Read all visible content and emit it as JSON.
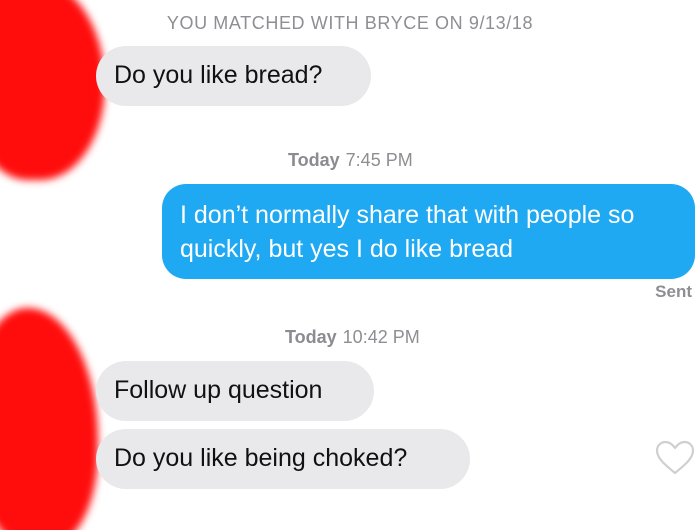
{
  "header": {
    "match_text": "YOU MATCHED WITH BRYCE ON 9/13/18"
  },
  "messages": [
    {
      "direction": "received",
      "text": "Do you like bread?"
    },
    {
      "direction": "sent",
      "text": "I don’t normally share that with people so quickly, but yes I do like bread"
    },
    {
      "direction": "received",
      "text": "Follow up question"
    },
    {
      "direction": "received",
      "text": "Do you like being choked?"
    }
  ],
  "timestamps": [
    {
      "day": "Today",
      "time": "7:45 PM"
    },
    {
      "day": "Today",
      "time": "10:42 PM"
    }
  ],
  "sent_status": "Sent",
  "icons": {
    "like": "heart-outline-icon"
  },
  "colors": {
    "sent_bubble": "#1fa9f2",
    "received_bubble": "#e9e9eb",
    "redaction": "#ff0d0d",
    "meta_text": "#8e8e93"
  }
}
